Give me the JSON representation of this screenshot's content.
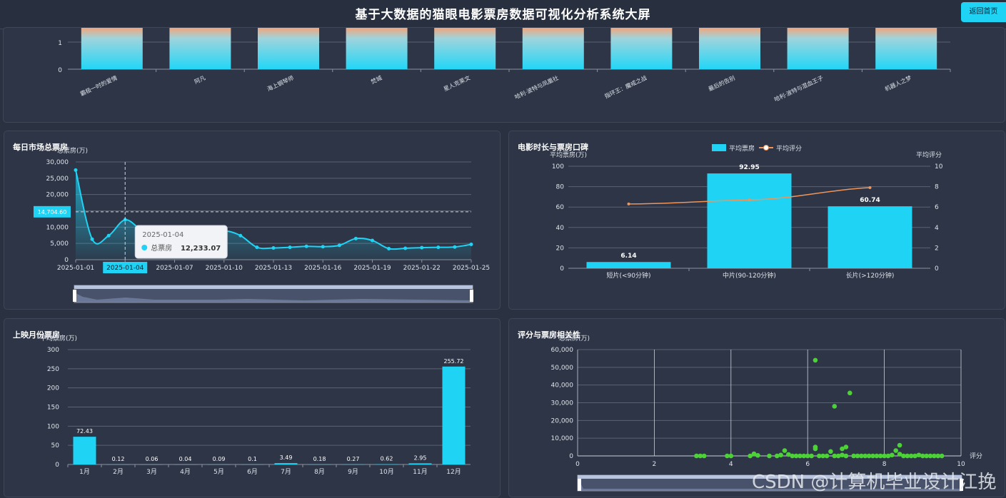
{
  "header": {
    "title": "基于大数据的猫眼电影票房数据可视化分析系统大屏",
    "back_label": "返回首页"
  },
  "colors": {
    "accent": "#00e0ff",
    "line": "#1fd3f5",
    "orange": "#f0955a",
    "green": "#4cd137"
  },
  "watermark": "CSDN @计算机毕业设计江挽",
  "chart_data": [
    {
      "id": "top",
      "type": "bar",
      "title": "",
      "ylim": [
        0,
        1
      ],
      "yticks": [
        "0",
        "1"
      ],
      "categories": [
        "霸极一时的爱情",
        "阿凡",
        "海上钢琴师",
        "焚城",
        "星人克莱文",
        "哈利·波特与凤凰社",
        "指环王：魔戒之战",
        "最后的告别",
        "哈利·波特与混血王子",
        "机器人之梦"
      ]
    },
    {
      "id": "daily",
      "type": "line",
      "title": "每日市场总票房",
      "ylabel": "总票房(万)",
      "ylim": [
        0,
        30000
      ],
      "yticks": [
        "0",
        "5,000",
        "10,000",
        "15,000",
        "20,000",
        "25,000",
        "30,000"
      ],
      "xticks": [
        "2025-01-01",
        "2025-01-04",
        "2025-01-07",
        "2025-01-10",
        "2025-01-13",
        "2025-01-16",
        "2025-01-19",
        "2025-01-22",
        "2025-01-25"
      ],
      "x": [
        "2025-01-01",
        "2025-01-02",
        "2025-01-03",
        "2025-01-04",
        "2025-01-05",
        "2025-01-06",
        "2025-01-07",
        "2025-01-08",
        "2025-01-09",
        "2025-01-10",
        "2025-01-11",
        "2025-01-12",
        "2025-01-13",
        "2025-01-14",
        "2025-01-15",
        "2025-01-16",
        "2025-01-17",
        "2025-01-18",
        "2025-01-19",
        "2025-01-20",
        "2025-01-21",
        "2025-01-22",
        "2025-01-23",
        "2025-01-24",
        "2025-01-25"
      ],
      "values": [
        27500,
        6300,
        7400,
        12233.07,
        9000,
        6500,
        5500,
        6500,
        7000,
        8800,
        7400,
        3800,
        3600,
        3800,
        4100,
        4000,
        4400,
        6500,
        5900,
        3400,
        3500,
        3700,
        3800,
        3900,
        4700
      ],
      "crosshair_label": "14,704.60",
      "crosshair_x_label": "2025-01-04",
      "tooltip": {
        "date": "2025-01-04",
        "series": "总票房",
        "value": "12,233.07"
      }
    },
    {
      "id": "duration",
      "type": "bar",
      "title": "电影时长与票房口碑",
      "ylabel": "平均票房(万)",
      "y2label": "平均评分",
      "ylim": [
        0,
        100
      ],
      "y2lim": [
        0,
        10
      ],
      "yticks": [
        "0",
        "20",
        "40",
        "60",
        "80",
        "100"
      ],
      "y2ticks": [
        "0",
        "2",
        "4",
        "6",
        "8",
        "10"
      ],
      "legend": [
        "平均票房",
        "平均评分"
      ],
      "categories": [
        "短片(<90分钟)",
        "中片(90-120分钟)",
        "长片(>120分钟)"
      ],
      "values": [
        6.14,
        92.95,
        60.74
      ],
      "value_labels": [
        "6.14",
        "92.95",
        "60.74"
      ],
      "line_values": [
        6.3,
        6.7,
        7.9
      ]
    },
    {
      "id": "monthly",
      "type": "bar",
      "title": "上映月份票房",
      "ylabel": "平均票房(万)",
      "ylim": [
        0,
        300
      ],
      "yticks": [
        "0",
        "50",
        "100",
        "150",
        "200",
        "250",
        "300"
      ],
      "categories": [
        "1月",
        "2月",
        "3月",
        "4月",
        "5月",
        "6月",
        "7月",
        "8月",
        "9月",
        "10月",
        "11月",
        "12月"
      ],
      "values": [
        72.43,
        0.12,
        0.06,
        0.04,
        0.09,
        0.1,
        3.49,
        0.18,
        0.27,
        0.62,
        2.95,
        255.72
      ],
      "value_labels": [
        "72.43",
        "0.12",
        "0.06",
        "0.04",
        "0.09",
        "0.1",
        "3.49",
        "0.18",
        "0.27",
        "0.62",
        "2.95",
        "255.72"
      ]
    },
    {
      "id": "scatter",
      "type": "scatter",
      "title": "评分与票房相关性",
      "ylabel": "总票房(万)",
      "xlabel": "评分",
      "xlim": [
        0,
        10
      ],
      "ylim": [
        0,
        60000
      ],
      "xticks": [
        "0",
        "2",
        "4",
        "6",
        "8",
        "10"
      ],
      "yticks": [
        "0",
        "10,000",
        "20,000",
        "30,000",
        "40,000",
        "50,000",
        "60,000"
      ],
      "points": [
        [
          3.1,
          0
        ],
        [
          3.2,
          0
        ],
        [
          3.3,
          0
        ],
        [
          3.9,
          0
        ],
        [
          4.0,
          0
        ],
        [
          4.5,
          0
        ],
        [
          4.6,
          1200
        ],
        [
          4.7,
          300
        ],
        [
          5.0,
          0
        ],
        [
          5.2,
          0
        ],
        [
          5.3,
          500
        ],
        [
          5.4,
          3000
        ],
        [
          5.5,
          800
        ],
        [
          5.6,
          0
        ],
        [
          5.7,
          0
        ],
        [
          5.8,
          0
        ],
        [
          5.9,
          0
        ],
        [
          6.0,
          0
        ],
        [
          6.1,
          0
        ],
        [
          6.2,
          54000
        ],
        [
          6.2,
          4000
        ],
        [
          6.2,
          5000
        ],
        [
          6.3,
          0
        ],
        [
          6.4,
          0
        ],
        [
          6.5,
          0
        ],
        [
          6.6,
          2500
        ],
        [
          6.7,
          0
        ],
        [
          6.7,
          28000
        ],
        [
          6.8,
          0
        ],
        [
          6.9,
          4000
        ],
        [
          6.9,
          500
        ],
        [
          7.0,
          5000
        ],
        [
          7.0,
          0
        ],
        [
          7.1,
          35500
        ],
        [
          7.2,
          0
        ],
        [
          7.3,
          0
        ],
        [
          7.4,
          0
        ],
        [
          7.5,
          0
        ],
        [
          7.6,
          0
        ],
        [
          7.7,
          0
        ],
        [
          7.8,
          0
        ],
        [
          7.9,
          0
        ],
        [
          8.0,
          0
        ],
        [
          8.1,
          0
        ],
        [
          8.2,
          500
        ],
        [
          8.3,
          3000
        ],
        [
          8.4,
          6000
        ],
        [
          8.4,
          1000
        ],
        [
          8.5,
          0
        ],
        [
          8.6,
          0
        ],
        [
          8.7,
          0
        ],
        [
          8.8,
          0
        ],
        [
          8.9,
          500
        ],
        [
          9.0,
          0
        ],
        [
          9.1,
          0
        ],
        [
          9.2,
          0
        ],
        [
          9.3,
          0
        ],
        [
          9.4,
          0
        ],
        [
          9.5,
          0
        ]
      ]
    }
  ]
}
